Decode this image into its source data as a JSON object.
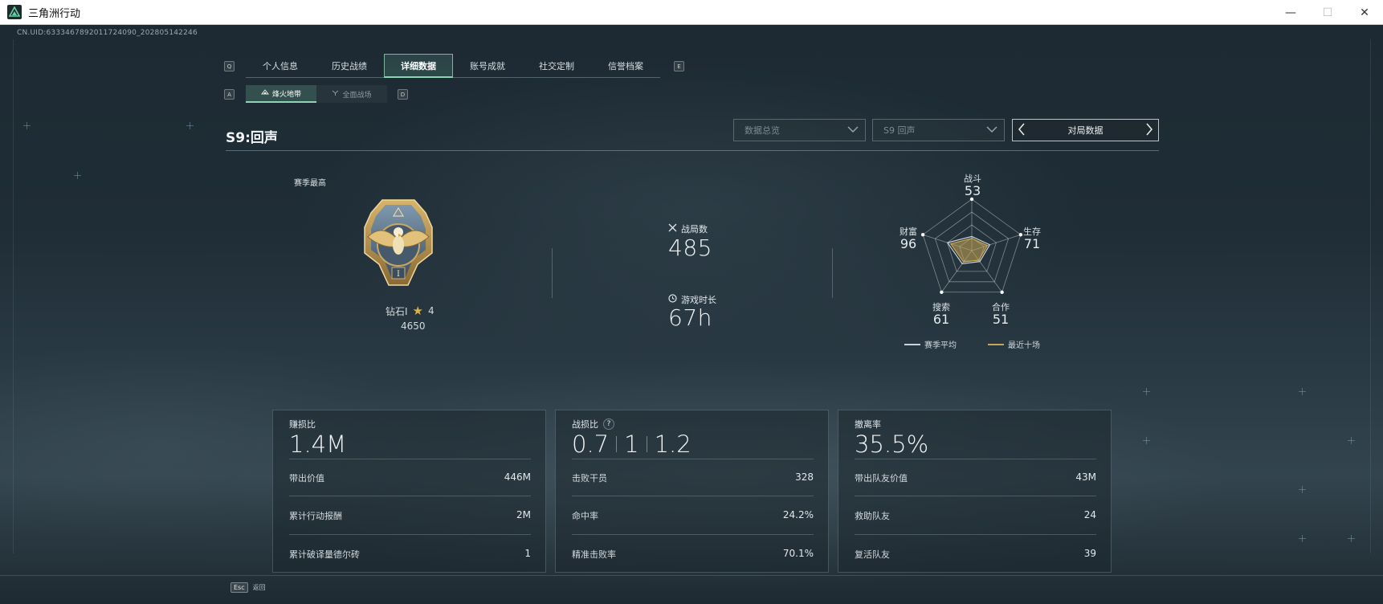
{
  "window": {
    "title": "三角洲行动",
    "controls": {
      "minimize": "—",
      "maximize": "☐",
      "close": "✕"
    }
  },
  "uid": "CN.UID:6333467892011724090_202805142246",
  "tabs": {
    "left_key": "Q",
    "right_key": "E",
    "items": [
      {
        "label": "个人信息",
        "active": false
      },
      {
        "label": "历史战绩",
        "active": false
      },
      {
        "label": "详细数据",
        "active": true
      },
      {
        "label": "账号成就",
        "active": false
      },
      {
        "label": "社交定制",
        "active": false
      },
      {
        "label": "信誉档案",
        "active": false
      }
    ]
  },
  "subtabs": {
    "left_key": "A",
    "right_key": "D",
    "items": [
      {
        "label": "烽火地带",
        "icon": "flame-zone-icon",
        "active": true
      },
      {
        "label": "全面战场",
        "icon": "battlefield-icon",
        "active": false
      }
    ]
  },
  "season": {
    "title": "S9:回声",
    "filters": [
      {
        "label": "数据总览"
      },
      {
        "label": "S9 回声"
      }
    ],
    "nav_label": "对局数据"
  },
  "rank": {
    "best_label": "赛季最高",
    "tier": "钻石I",
    "stars": "4",
    "score": "4650",
    "medal_icon": "eagle-medal-icon"
  },
  "overview": {
    "matches_label": "战局数",
    "matches_value": "485",
    "playtime_label": "游戏时长",
    "playtime_value": "67h"
  },
  "radar": {
    "axes": [
      {
        "label": "战斗",
        "value": "53"
      },
      {
        "label": "生存",
        "value": "71"
      },
      {
        "label": "合作",
        "value": "51"
      },
      {
        "label": "搜索",
        "value": "61"
      },
      {
        "label": "财富",
        "value": "96"
      }
    ],
    "legend": [
      {
        "label": "赛季平均",
        "color": "#c8d2d8"
      },
      {
        "label": "最近十场",
        "color": "#c9a653"
      }
    ]
  },
  "cards": [
    {
      "title": "赚损比",
      "big": "1.4M",
      "rows": [
        {
          "label": "带出价值",
          "value": "446M"
        },
        {
          "label": "累计行动报酬",
          "value": "2M"
        },
        {
          "label": "累计破译量德尔砖",
          "value": "1"
        }
      ]
    },
    {
      "title": "战损比",
      "help": "?",
      "ratio": [
        "0.7",
        "1",
        "1.2"
      ],
      "rows": [
        {
          "label": "击败干员",
          "value": "328"
        },
        {
          "label": "命中率",
          "value": "24.2%"
        },
        {
          "label": "精准击败率",
          "value": "70.1%"
        }
      ]
    },
    {
      "title": "撤离率",
      "big": "35.5%",
      "rows": [
        {
          "label": "带出队友价值",
          "value": "43M"
        },
        {
          "label": "救助队友",
          "value": "24"
        },
        {
          "label": "复活队友",
          "value": "39"
        }
      ]
    }
  ],
  "footer": {
    "esc_key": "Esc",
    "esc_label": "返回"
  }
}
